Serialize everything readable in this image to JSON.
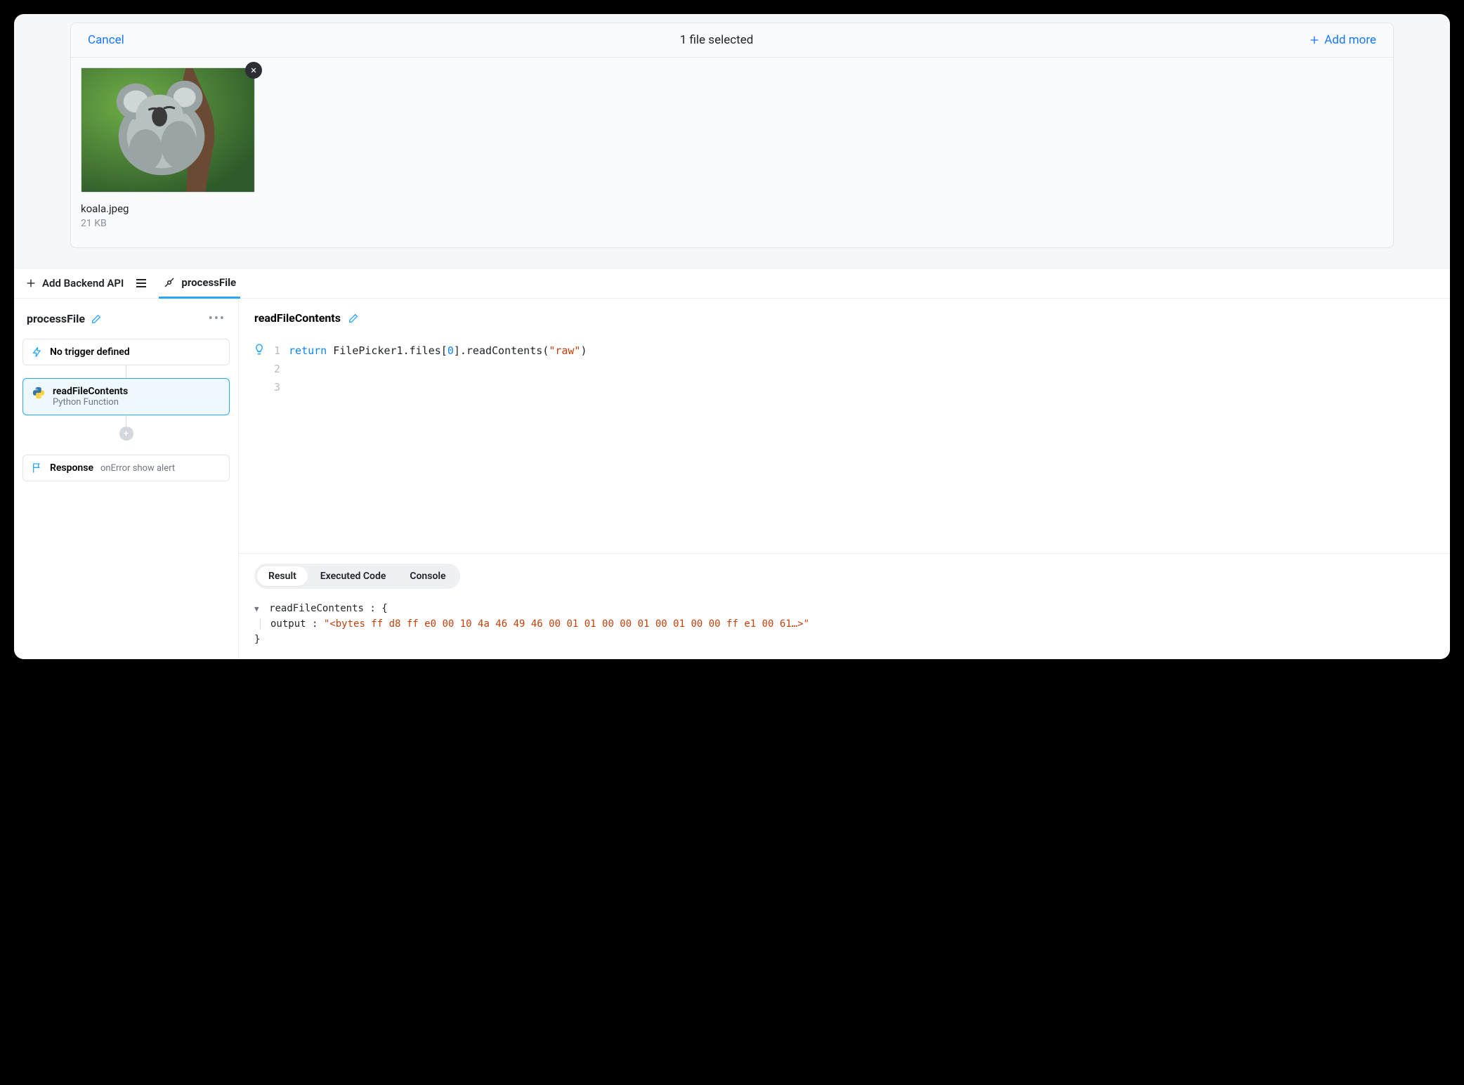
{
  "picker": {
    "cancel": "Cancel",
    "title": "1 file selected",
    "add_more": "Add more",
    "files": [
      {
        "name": "koala.jpeg",
        "size": "21 KB"
      }
    ]
  },
  "apibar": {
    "add_backend": "Add Backend API",
    "tab_label": "processFile"
  },
  "flow": {
    "name": "processFile",
    "trigger_label": "No trigger defined",
    "step": {
      "name": "readFileContents",
      "type": "Python Function"
    },
    "response_label": "Response",
    "response_detail": "onError show alert"
  },
  "editor": {
    "title": "readFileContents",
    "lines": [
      "1",
      "2",
      "3"
    ],
    "code": {
      "kw": "return",
      "obj": "FilePicker1",
      "prop": ".files[",
      "index": "0",
      "after": "].readContents(",
      "arg": "\"raw\"",
      "end": ")"
    }
  },
  "results": {
    "tabs": [
      "Result",
      "Executed Code",
      "Console"
    ],
    "active_tab": 0,
    "key": "readFileContents",
    "brace_open": ": {",
    "output_key": "output :",
    "output_val": "\"<bytes ff d8 ff e0 00 10 4a 46 49 46 00 01 01 00 00 01 00 01 00 00 ff e1 00 61…>\"",
    "brace_close": "}"
  }
}
